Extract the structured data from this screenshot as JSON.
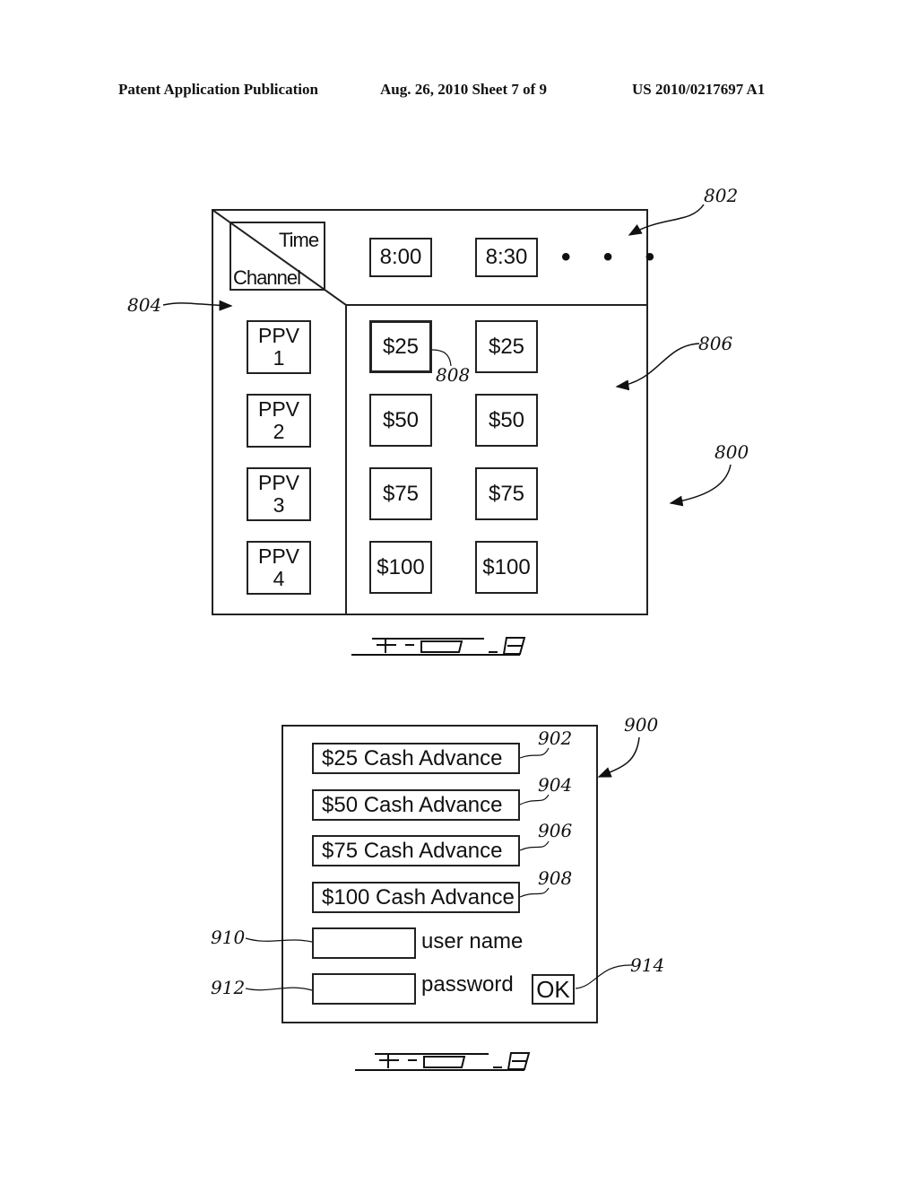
{
  "header": {
    "publication": "Patent Application Publication",
    "date_sheet": "Aug. 26, 2010  Sheet 7 of 9",
    "patent_number": "US 2010/0217697 A1"
  },
  "fig8": {
    "caption": "FIG. 8",
    "corner": {
      "top_label": "Time",
      "bottom_label": "Channel"
    },
    "times": [
      "8:00",
      "8:30"
    ],
    "more_indicator": "• • •",
    "channels": [
      {
        "line1": "PPV",
        "line2": "1"
      },
      {
        "line1": "PPV",
        "line2": "2"
      },
      {
        "line1": "PPV",
        "line2": "3"
      },
      {
        "line1": "PPV",
        "line2": "4"
      }
    ],
    "grid": [
      [
        "$25",
        "$25"
      ],
      [
        "$50",
        "$50"
      ],
      [
        "$75",
        "$75"
      ],
      [
        "$100",
        "$100"
      ]
    ],
    "selected_cell": "$25 (PPV 1, 8:00)",
    "refs": {
      "guide": "800",
      "time_bar": "802",
      "channel_column": "804",
      "price_grid": "806",
      "selected_cell": "808"
    }
  },
  "fig9": {
    "caption": "FIG. 9",
    "advance_options": [
      {
        "label": "$25 Cash Advance",
        "ref": "902"
      },
      {
        "label": "$50 Cash Advance",
        "ref": "904"
      },
      {
        "label": "$75 Cash Advance",
        "ref": "906"
      },
      {
        "label": "$100 Cash Advance",
        "ref": "908"
      }
    ],
    "username": {
      "label": "user name",
      "value": "",
      "ref": "910"
    },
    "password": {
      "label": "password",
      "value": "",
      "ref": "912"
    },
    "ok_button": {
      "label": "OK",
      "ref": "914"
    },
    "refs": {
      "dialog": "900"
    }
  }
}
